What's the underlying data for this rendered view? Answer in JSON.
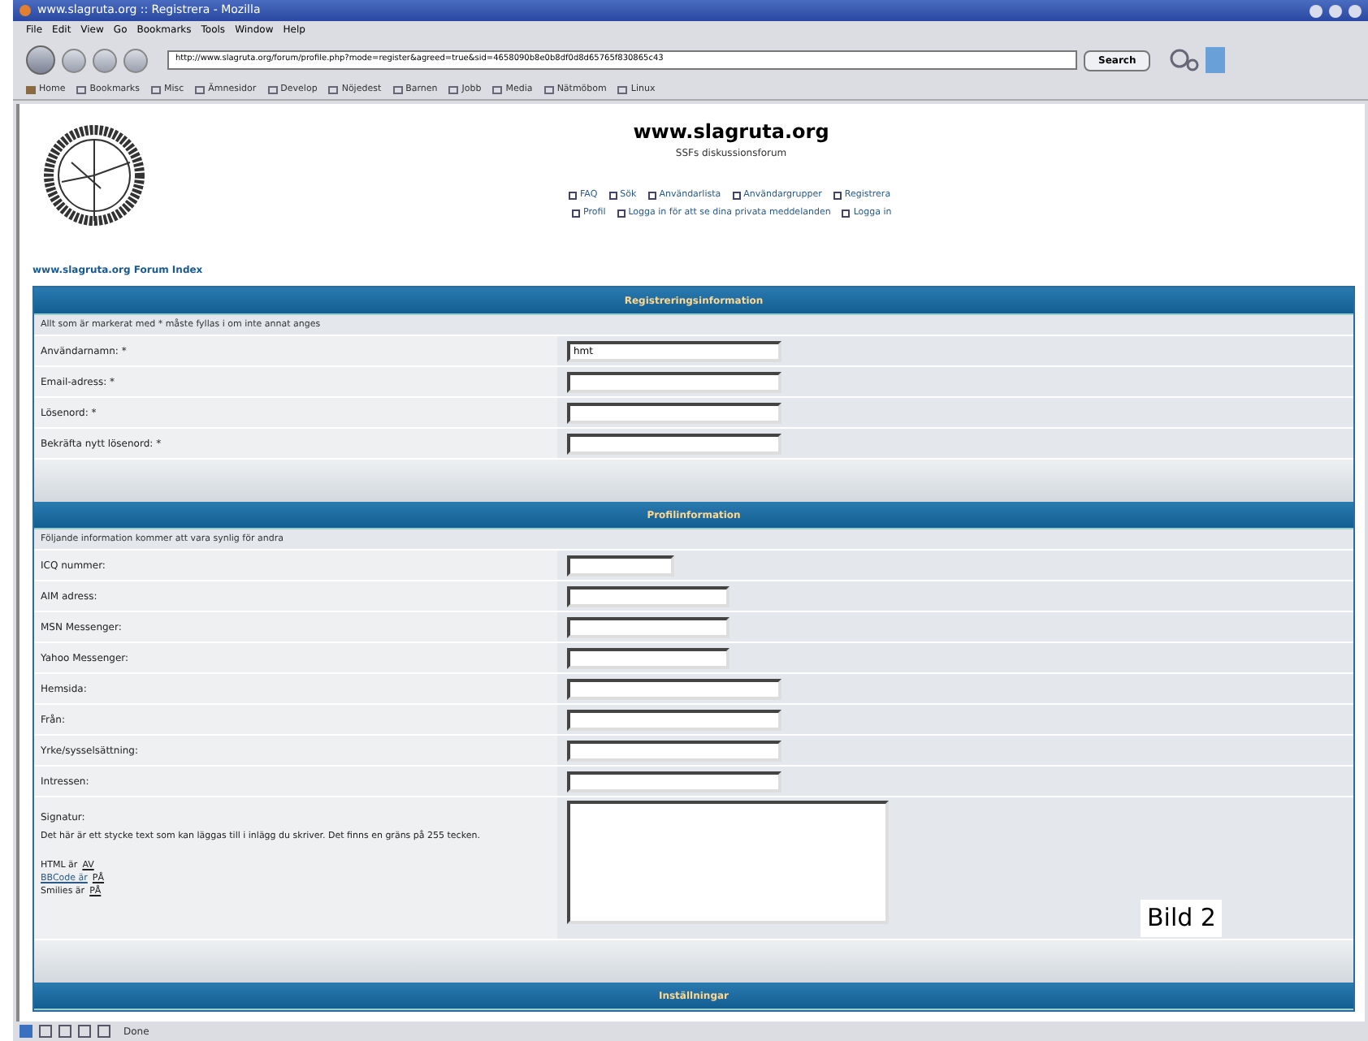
{
  "window": {
    "title": "www.slagruta.org :: Registrera - Mozilla"
  },
  "menu": [
    "File",
    "Edit",
    "View",
    "Go",
    "Bookmarks",
    "Tools",
    "Window",
    "Help"
  ],
  "address": {
    "value": "http://www.slagruta.org/forum/profile.php?mode=register&agreed=true&sid=4658090b8e0b8df0d8d65765f830865c43"
  },
  "search_button": "Search",
  "bookmarks": [
    {
      "label": "Home",
      "kind": "home"
    },
    {
      "label": "Bookmarks",
      "kind": "folder"
    },
    {
      "label": "Misc",
      "kind": "folder"
    },
    {
      "label": "Ämnesidor",
      "kind": "folder"
    },
    {
      "label": "Develop",
      "kind": "folder"
    },
    {
      "label": "Nöjedest",
      "kind": "folder"
    },
    {
      "label": "Barnen",
      "kind": "folder"
    },
    {
      "label": "Jobb",
      "kind": "folder"
    },
    {
      "label": "Media",
      "kind": "folder"
    },
    {
      "label": "Nätmöbom",
      "kind": "folder"
    },
    {
      "label": "Linux",
      "kind": "folder"
    }
  ],
  "site": {
    "title": "www.slagruta.org",
    "subtitle": "SSFs diskussionsforum"
  },
  "nav_links": [
    [
      {
        "label": "FAQ"
      },
      {
        "label": "Sök"
      },
      {
        "label": "Användarlista"
      },
      {
        "label": "Användargrupper"
      },
      {
        "label": "Registrera"
      }
    ],
    [
      {
        "label": "Profil"
      },
      {
        "label": "Logga in för att se dina privata meddelanden"
      },
      {
        "label": "Logga in"
      }
    ]
  ],
  "breadcrumb": "www.slagruta.org Forum Index",
  "sections": [
    {
      "title": "Registreringsinformation",
      "note": "Allt som är markerat med * måste fyllas i om inte annat anges",
      "fields": [
        {
          "label": "Användarnamn: *",
          "kind": "long",
          "value": "hmt"
        },
        {
          "label": "Email-adress: *",
          "kind": "long"
        },
        {
          "label": "Lösenord: *",
          "kind": "long"
        },
        {
          "label": "Bekräfta nytt lösenord: *",
          "kind": "long"
        }
      ]
    },
    {
      "title": "Profilinformation",
      "note": "Följande information kommer att vara synlig för andra",
      "fields": [
        {
          "label": "ICQ nummer:",
          "kind": "short"
        },
        {
          "label": "AIM adress:",
          "kind": "medium"
        },
        {
          "label": "MSN Messenger:",
          "kind": "medium"
        },
        {
          "label": "Yahoo Messenger:",
          "kind": "medium"
        },
        {
          "label": "Hemsida:",
          "kind": "long"
        },
        {
          "label": "Från:",
          "kind": "long"
        },
        {
          "label": "Yrke/sysselsättning:",
          "kind": "long"
        },
        {
          "label": "Intressen:",
          "kind": "long"
        },
        {
          "label": "Signatur:",
          "kind": "textarea",
          "description": "Det här är ett stycke text som kan läggas till i inlägg du skriver. Det finns en gräns på 255 tecken.",
          "notes": [
            {
              "text": "HTML är",
              "link": "AV",
              "kind": "plain"
            },
            {
              "text": "BBCode är",
              "link": "PÅ",
              "kind": "link"
            },
            {
              "text": "Smilies är",
              "link": "PÅ",
              "kind": "plain"
            }
          ]
        }
      ]
    },
    {
      "title": "Inställningar"
    }
  ],
  "status": "Done",
  "caption": "Bild 2"
}
